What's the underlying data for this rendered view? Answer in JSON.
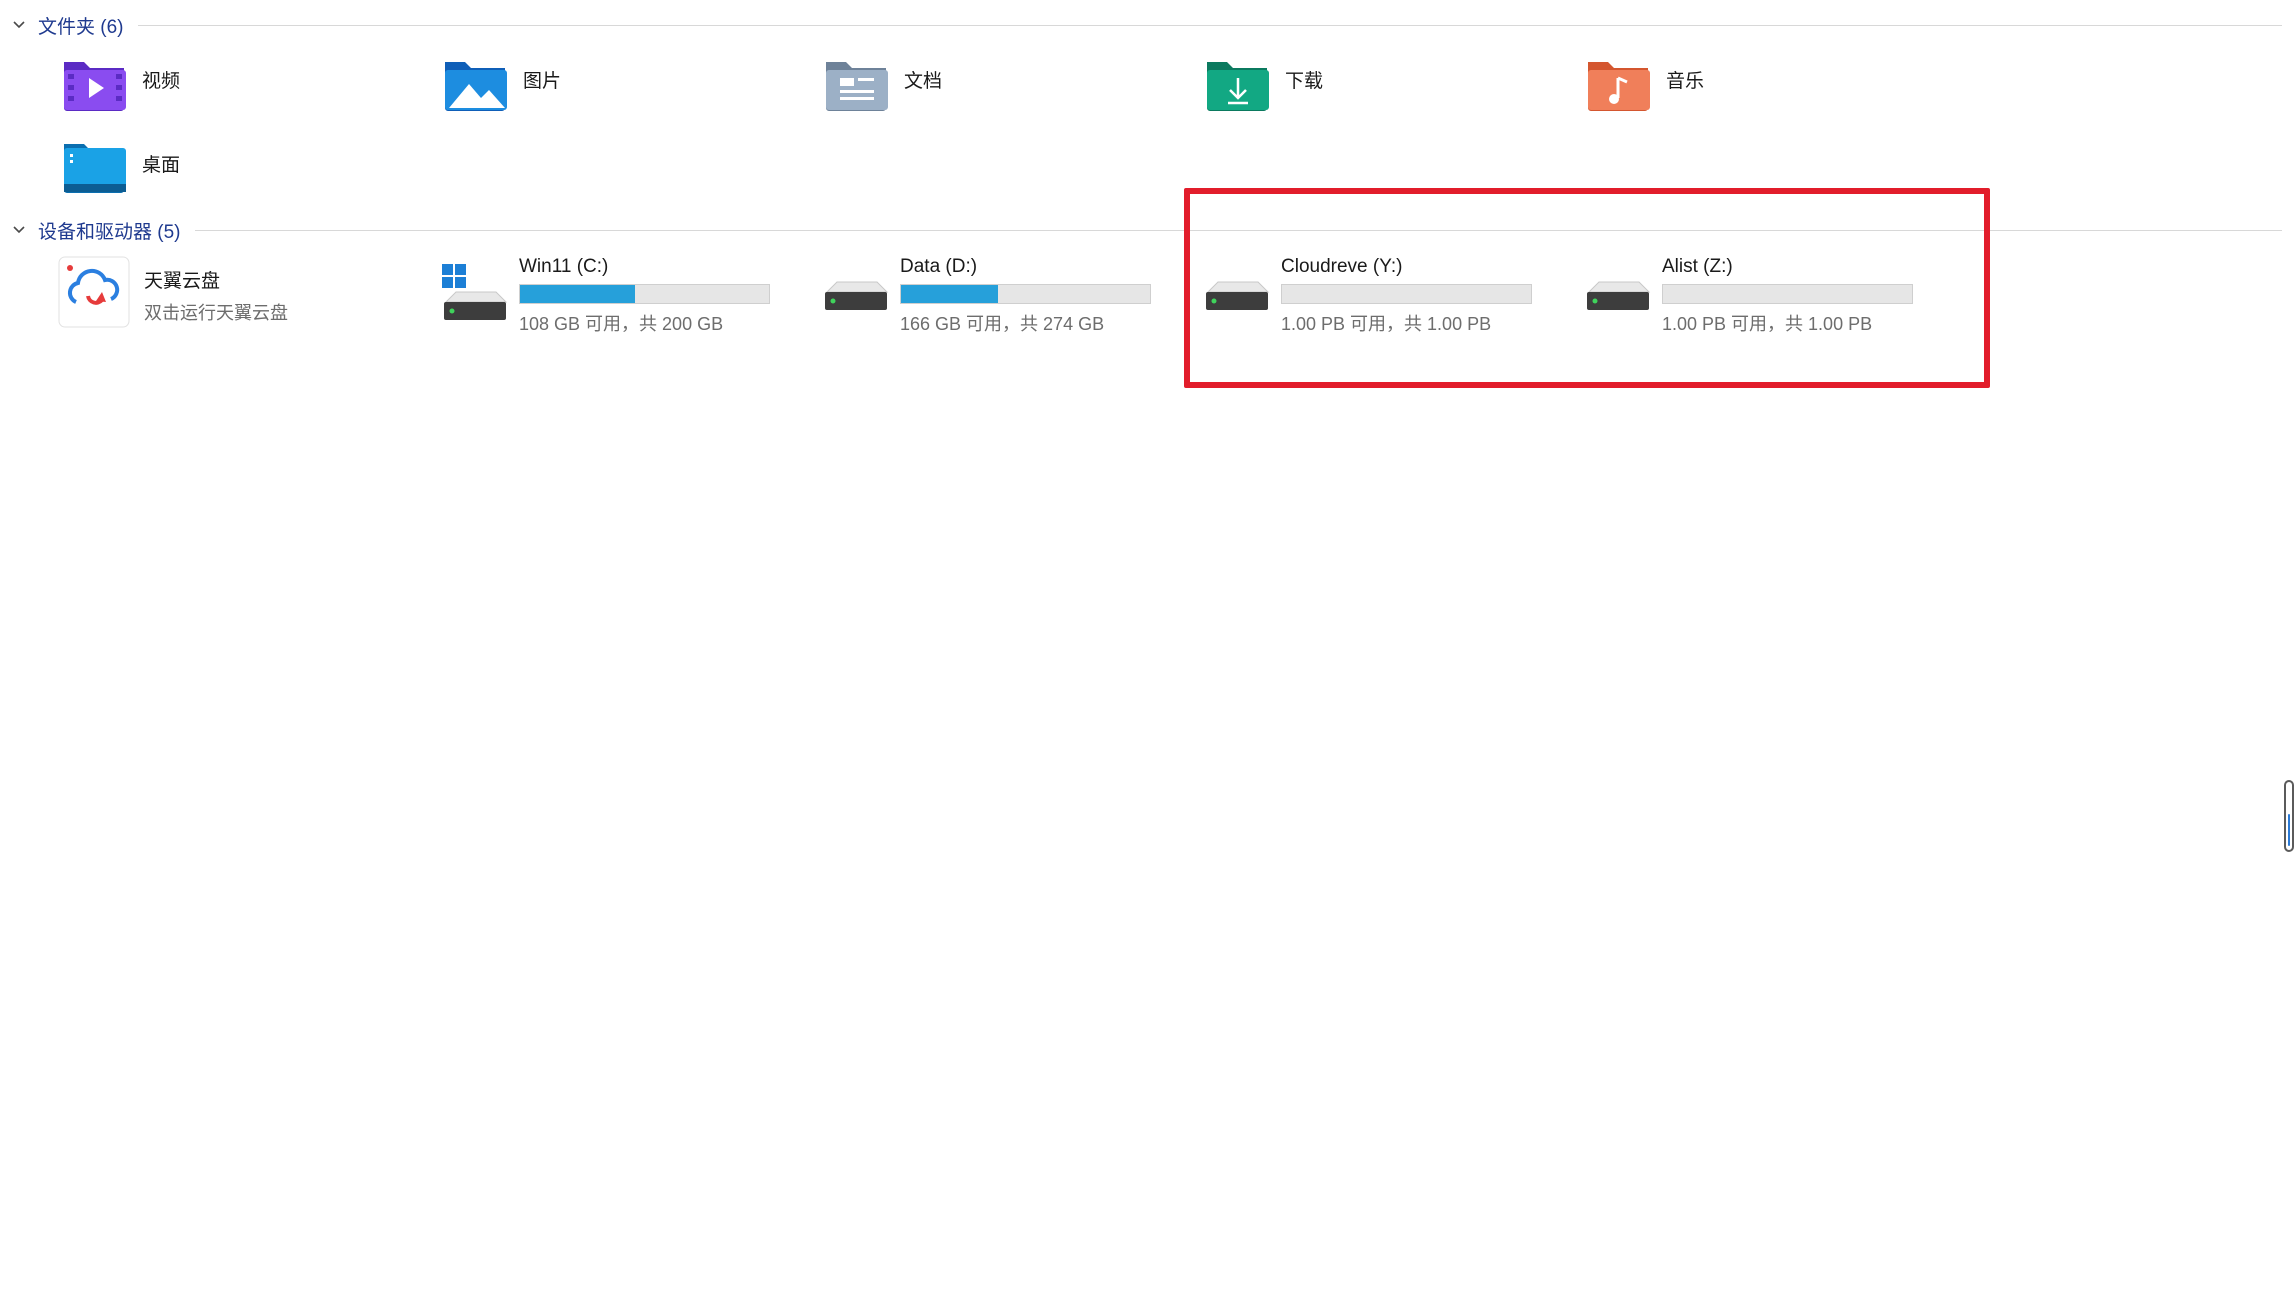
{
  "sections": {
    "folders": {
      "title": "文件夹 (6)"
    },
    "devices": {
      "title": "设备和驱动器 (5)"
    }
  },
  "folders": [
    {
      "label": "视频",
      "icon": "video-folder-icon",
      "color": "#7b3fe4"
    },
    {
      "label": "图片",
      "icon": "pictures-folder-icon",
      "color": "#1d8de0"
    },
    {
      "label": "文档",
      "icon": "documents-folder-icon",
      "color": "#8aa0b8"
    },
    {
      "label": "下载",
      "icon": "downloads-folder-icon",
      "color": "#10a37f"
    },
    {
      "label": "音乐",
      "icon": "music-folder-icon",
      "color": "#ee6a4a"
    },
    {
      "label": "桌面",
      "icon": "desktop-folder-icon",
      "color": "#1a9ee0"
    }
  ],
  "cloud_app": {
    "name": "天翼云盘",
    "subtitle": "双击运行天翼云盘",
    "icon": "tianyi-cloud-icon"
  },
  "drives": [
    {
      "name": "Win11 (C:)",
      "info": "108 GB 可用，共 200 GB",
      "used_fraction": 0.46,
      "icon": "windows-drive-icon"
    },
    {
      "name": "Data (D:)",
      "info": "166 GB 可用，共 274 GB",
      "used_fraction": 0.39,
      "icon": "hard-drive-icon"
    },
    {
      "name": "Cloudreve (Y:)",
      "info": "1.00 PB 可用，共 1.00 PB",
      "used_fraction": 0.0,
      "icon": "hard-drive-icon"
    },
    {
      "name": "Alist (Z:)",
      "info": "1.00 PB 可用，共 1.00 PB",
      "used_fraction": 0.0,
      "icon": "hard-drive-icon"
    }
  ],
  "colors": {
    "accent": "#26a0da",
    "highlight": "#e21d2b",
    "section_title": "#1f3a8f"
  }
}
